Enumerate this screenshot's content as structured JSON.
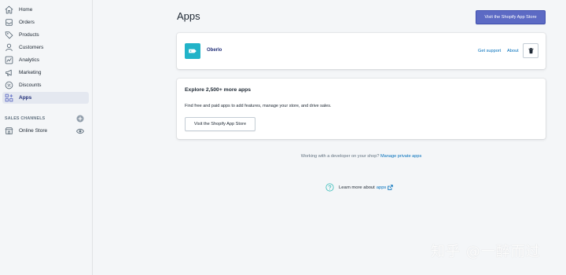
{
  "sidebar": {
    "items": [
      {
        "label": "Home",
        "icon": "home-icon"
      },
      {
        "label": "Orders",
        "icon": "orders-icon"
      },
      {
        "label": "Products",
        "icon": "tag-icon"
      },
      {
        "label": "Customers",
        "icon": "person-icon"
      },
      {
        "label": "Analytics",
        "icon": "analytics-icon"
      },
      {
        "label": "Marketing",
        "icon": "megaphone-icon"
      },
      {
        "label": "Discounts",
        "icon": "discount-icon"
      },
      {
        "label": "Apps",
        "icon": "apps-icon",
        "active": true
      }
    ],
    "sales_channels_title": "SALES CHANNELS",
    "online_store": {
      "label": "Online Store",
      "icon": "store-icon"
    }
  },
  "header": {
    "title": "Apps",
    "primary_button": "Visit the Shopify App Store"
  },
  "installed_app": {
    "name": "Oberlo",
    "get_support": "Get support",
    "about": "About"
  },
  "explore": {
    "heading": "Explore 2,500+ more apps",
    "description": "Find free and paid apps to add features, manage your store, and drive sales.",
    "button": "Visit the Shopify App Store"
  },
  "developer": {
    "text": "Working with a developer on your shop?",
    "link": "Manage private apps"
  },
  "learn_more": {
    "text": "Learn more about",
    "link": "apps"
  },
  "watermark": "知乎 @一醉而过",
  "colors": {
    "accent": "#5c6ac4",
    "link": "#006fbb",
    "logo_bg": "#22b3c8",
    "active_nav_bg": "#e4e8f0"
  }
}
